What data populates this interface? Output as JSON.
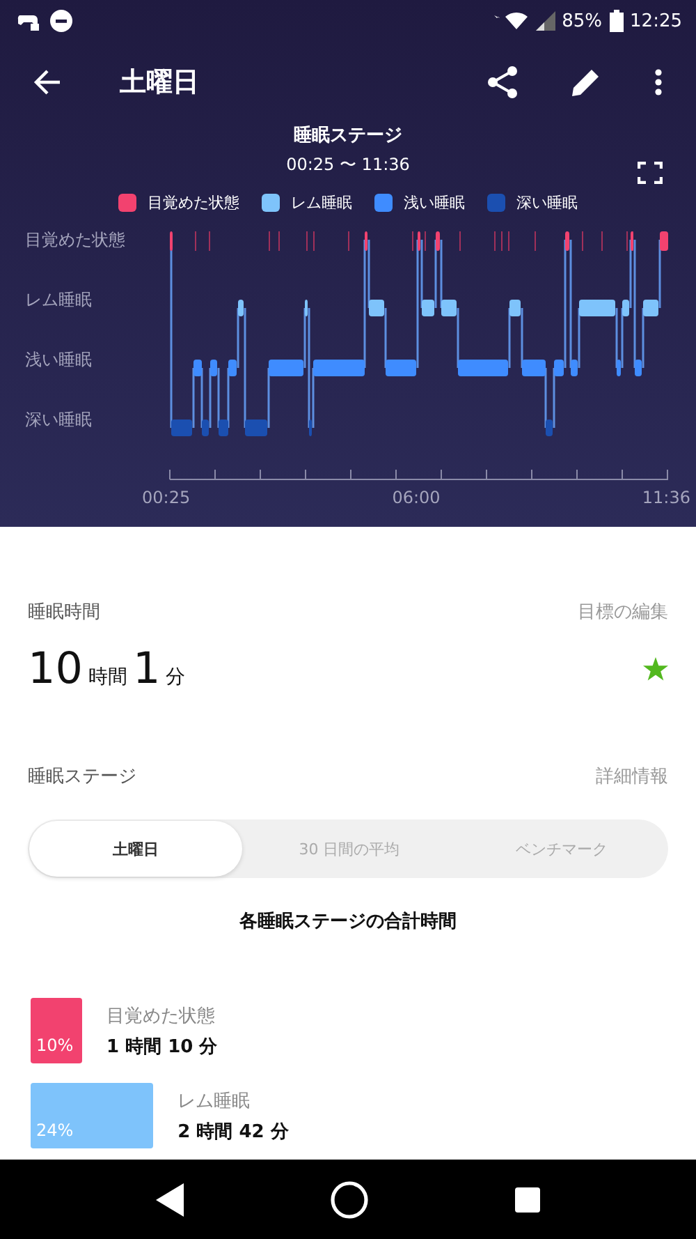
{
  "status_bar": {
    "battery": "85%",
    "time": "12:25"
  },
  "header": {
    "title": "土曜日"
  },
  "chart": {
    "title": "睡眠ステージ",
    "range": "00:25 〜 11:36",
    "legend": [
      {
        "label": "目覚めた状態",
        "color": "#f2426f"
      },
      {
        "label": "レム睡眠",
        "color": "#7ec3fb"
      },
      {
        "label": "浅い睡眠",
        "color": "#3f8cff"
      },
      {
        "label": "深い睡眠",
        "color": "#1b4fb0"
      }
    ],
    "y_labels": [
      "目覚めた状態",
      "レム睡眠",
      "浅い睡眠",
      "深い睡眠"
    ],
    "x_labels": [
      "00:25",
      "06:00",
      "11:36"
    ]
  },
  "sleep_time": {
    "label": "睡眠時間",
    "action": "目標の編集",
    "hours": "10",
    "hours_unit": "時間",
    "minutes": "1",
    "minutes_unit": "分"
  },
  "stages": {
    "label": "睡眠ステージ",
    "action": "詳細情報",
    "tabs": [
      {
        "label": "土曜日",
        "selected": true
      },
      {
        "label": "30 日間の平均",
        "selected": false
      },
      {
        "label": "ベンチマーク",
        "selected": false
      }
    ],
    "subtitle": "各睡眠ステージの合計時間",
    "rows": [
      {
        "name": "目覚めた状態",
        "duration": "1 時間 10 分",
        "percent": "10%",
        "color": "#f2426f"
      },
      {
        "name": "レム睡眠",
        "duration": "2 時間 42 分",
        "percent": "24%",
        "color": "#7ec3fb"
      }
    ]
  }
}
